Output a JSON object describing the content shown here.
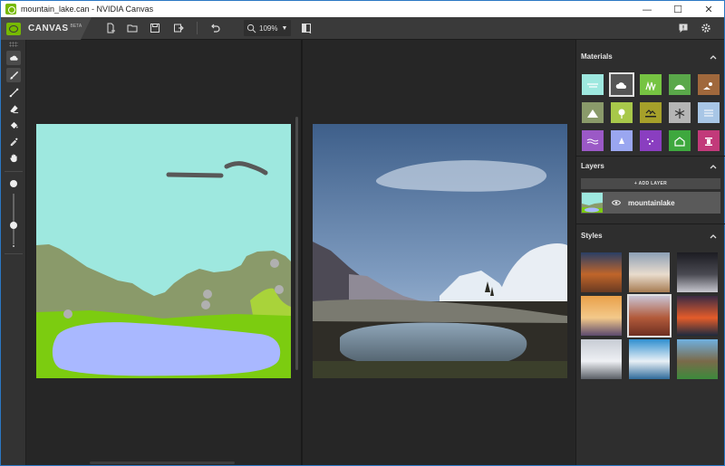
{
  "window": {
    "title": "mountain_lake.can - NVIDIA Canvas",
    "controls": [
      "—",
      "☐",
      "✕"
    ]
  },
  "toolbar": {
    "brand": "CANVAS",
    "brand_badge": "BETA",
    "buttons": [
      "new-file-icon",
      "open-folder-icon",
      "save-icon",
      "export-icon",
      "undo-icon",
      "split-view-icon"
    ],
    "zoom_value": "109%",
    "right_buttons": [
      "feedback-icon",
      "settings-icon"
    ]
  },
  "tools": [
    "material-brush-icon",
    "paint-brush-icon",
    "line-icon",
    "eraser-icon",
    "fill-bucket-icon",
    "eyedropper-icon",
    "hand-pan-icon"
  ],
  "brush_size_fraction": 0.62,
  "materials": {
    "title": "Materials",
    "items": [
      {
        "name": "sky",
        "color": "#9ee8df"
      },
      {
        "name": "cloud",
        "color": "#555555"
      },
      {
        "name": "grass",
        "color": "#76c442"
      },
      {
        "name": "hill",
        "color": "#5aa84a"
      },
      {
        "name": "dirt",
        "color": "#a0683c"
      },
      {
        "name": "mountain",
        "color": "#8a9a6a"
      },
      {
        "name": "tree",
        "color": "#a8c84a"
      },
      {
        "name": "bush",
        "color": "#a6a02a"
      },
      {
        "name": "snow",
        "color": "#b5b5b5"
      },
      {
        "name": "fog",
        "color": "#a8c6e6"
      },
      {
        "name": "water",
        "color": "#9b59c6"
      },
      {
        "name": "ice",
        "color": "#9aa6f0"
      },
      {
        "name": "sparkle",
        "color": "#8a3ec0"
      },
      {
        "name": "building",
        "color": "#3ea83e"
      },
      {
        "name": "pillar",
        "color": "#c23a7a"
      }
    ]
  },
  "layers": {
    "title": "Layers",
    "add_label": "+ ADD LAYER",
    "items": [
      {
        "name": "mountainlake"
      }
    ]
  },
  "styles": {
    "title": "Styles",
    "items": [
      "desert-canyon",
      "misty-peaks",
      "cave-arch",
      "sunset-clouds",
      "red-rocks",
      "ocean-sunset",
      "snowy-mountain",
      "alpine-lake",
      "mountain-lake-green"
    ]
  },
  "colors": {
    "accent": "#76b900",
    "sky": "#9ee8df",
    "grass": "#7ccc10",
    "water": "#a9b8ff",
    "mountain": "#8a9a6a"
  }
}
